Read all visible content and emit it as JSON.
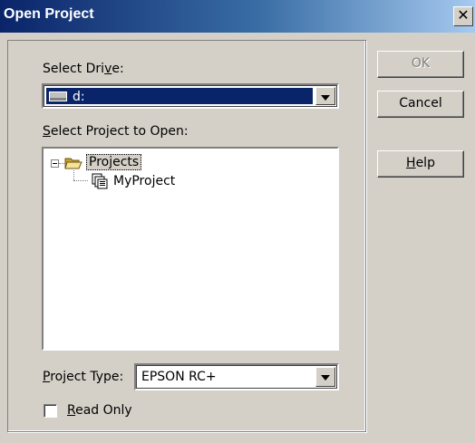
{
  "window": {
    "title": "Open Project",
    "close_glyph": "✕"
  },
  "drive": {
    "label_pre": "Select Dri",
    "label_ul": "v",
    "label_post": "e:",
    "value": "d:"
  },
  "projects": {
    "label_ul": "S",
    "label_post": "elect Project to Open:",
    "tree": [
      {
        "label": "Projects"
      },
      {
        "label": "MyProject"
      }
    ]
  },
  "project_type": {
    "label_ul": "P",
    "label_post": "roject Type:",
    "value": "EPSON RC+"
  },
  "read_only": {
    "label_ul": "R",
    "label_post": "ead Only",
    "checked": false
  },
  "buttons": {
    "ok": "OK",
    "cancel": "Cancel",
    "help_ul": "H",
    "help_post": "elp"
  }
}
